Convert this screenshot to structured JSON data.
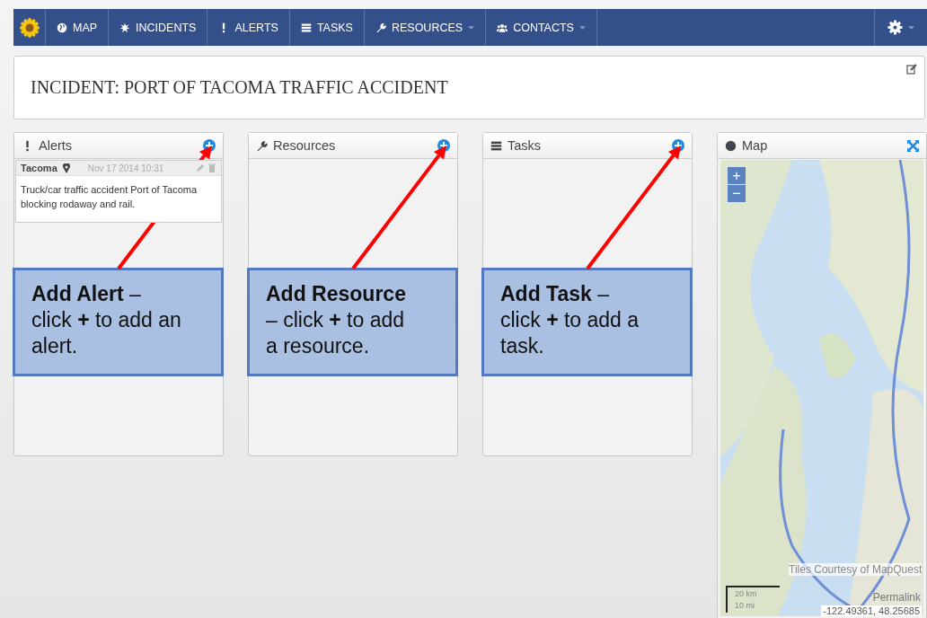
{
  "navbar": {
    "items": [
      {
        "label": "MAP",
        "dropdown": false
      },
      {
        "label": "INCIDENTS",
        "dropdown": false
      },
      {
        "label": "ALERTS",
        "dropdown": false
      },
      {
        "label": "TASKS",
        "dropdown": false
      },
      {
        "label": "RESOURCES",
        "dropdown": true
      },
      {
        "label": "CONTACTS",
        "dropdown": true
      }
    ],
    "settings": {
      "dropdown": true
    }
  },
  "incident": {
    "title": "INCIDENT: PORT OF TACOMA TRAFFIC ACCIDENT"
  },
  "panels": [
    {
      "title": "Alerts",
      "items": [
        {
          "location": "Tacoma",
          "time": "Nov 17 2014 10:31",
          "text": "Truck/car traffic accident Port of Tacoma blocking rodaway and rail."
        }
      ],
      "callout": "**Add Alert** – click **+** to add an alert."
    },
    {
      "title": "Resources",
      "callout": "**Add Resource** – click **+** to add a resource."
    },
    {
      "title": "Tasks",
      "callout": "**Add Task** – click **+** to add a task."
    }
  ],
  "map": {
    "title": "Map",
    "zoom_in": "+",
    "zoom_out": "−",
    "attribution": "Tiles Courtesy of MapQuest",
    "permalink": "Permalink",
    "coordinates": "-122.49361, 48.25685",
    "scale": [
      "20 km",
      "10 mi"
    ]
  }
}
